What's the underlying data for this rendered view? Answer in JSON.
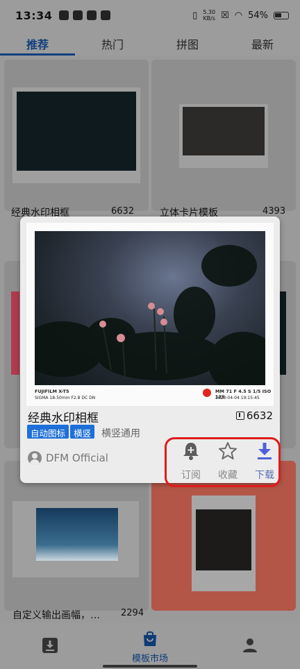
{
  "status_bar": {
    "time": "13:34",
    "net_speed_value": "5.30",
    "net_speed_unit": "KB/s",
    "battery": "54%"
  },
  "tabs": [
    {
      "label": "推荐",
      "active": true
    },
    {
      "label": "热门",
      "active": false
    },
    {
      "label": "拼图",
      "active": false
    },
    {
      "label": "最新",
      "active": false
    }
  ],
  "background_cards": [
    {
      "title": "经典水印相框",
      "downloads": "6632"
    },
    {
      "title": "立体卡片模板",
      "downloads": "4393"
    },
    {
      "title": "自定义输出画幅，…",
      "downloads": "2294"
    }
  ],
  "popup": {
    "title": "经典水印相框",
    "downloads": "6632",
    "tags": [
      "自动图标",
      "横竖"
    ],
    "tag_plain": "横竖通用",
    "author": "DFM Official",
    "watermark": {
      "camera": "FUJIFILM X-T5",
      "lens": "SIGMA 18-50mm F2.8 DC DN",
      "exif": "MM 71  F 4.5  S 1/5  ISO 125",
      "datetime": "2023-04-04 19:15:45"
    },
    "actions": [
      {
        "label": "订阅",
        "icon": "bell-plus-icon"
      },
      {
        "label": "收藏",
        "icon": "star-outline-icon"
      },
      {
        "label": "下载",
        "icon": "download-icon"
      }
    ]
  },
  "bottom_nav": {
    "market_label": "模板市场"
  },
  "colors": {
    "accent": "#103e7e",
    "tag_blue": "#1e6fd9",
    "highlight_red": "#e01b1b",
    "download_icon": "#5060d8"
  }
}
